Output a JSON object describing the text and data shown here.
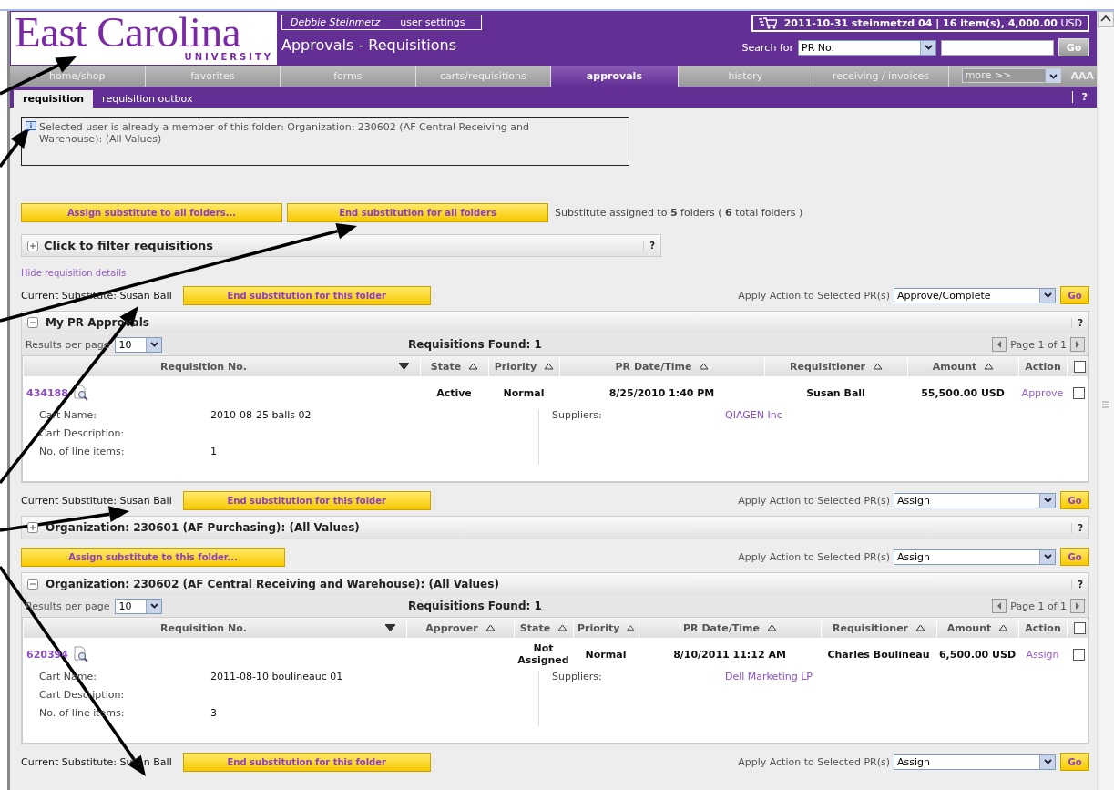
{
  "logo": {
    "name": "East Carolina",
    "sub": "UNIVERSITY"
  },
  "user": {
    "name": "Debbie Steinmetz",
    "settings": "user settings"
  },
  "page_title": "Approvals - Requisitions",
  "cart": {
    "summary": "**2011-10-31 steinmetzd 04 | 16 item(s), 4,000.00** USD"
  },
  "search": {
    "label": "Search for",
    "option": "PR No.",
    "go": "Go"
  },
  "nav": [
    {
      "label": "home/shop",
      "selected": false
    },
    {
      "label": "favorites",
      "selected": false
    },
    {
      "label": "forms",
      "selected": false
    },
    {
      "label": "carts/requisitions",
      "selected": false
    },
    {
      "label": "approvals",
      "selected": true
    },
    {
      "label": "history",
      "selected": false
    },
    {
      "label": "receiving / invoices",
      "selected": false
    }
  ],
  "more": "more >>",
  "text_size": "AAA",
  "subtabs": [
    {
      "label": "requisition",
      "selected": true
    },
    {
      "label": "requisition outbox",
      "selected": false
    }
  ],
  "help": "?",
  "notice": "Selected user is already a member of this folder: Organization: 230602 (AF Central Receiving and Warehouse): (All Values)",
  "bulk_buttons": [
    "Assign substitute to all folders...",
    "End substitution for all folders"
  ],
  "summary": "Substitute assigned to **5** folders ( **6** total folders )",
  "filter": {
    "label": "Click to filter requisitions",
    "help": "?"
  },
  "details_link": "Hide requisition details",
  "folders": [
    {
      "bar": {
        "substitute": "Current Substitute: Susan Ball",
        "button": "End substitution for this folder",
        "apply_label": "Apply Action to Selected PR(s)",
        "action": "Approve/Complete",
        "go": "Go"
      },
      "title": "My PR Approvals",
      "expanded": true,
      "help": "?",
      "results_label": "Results per page",
      "per_page": "10",
      "found": "Requisitions Found: 1",
      "page": "Page 1 of 1",
      "select_all_checked": false,
      "columns": [
        {
          "label": "Requisition No.",
          "sorted": true
        },
        {
          "label": "State",
          "sorted": false
        },
        {
          "label": "Priority",
          "sorted": false
        },
        {
          "label": "PR Date/Time",
          "sorted": false
        },
        {
          "label": "Requisitioner",
          "sorted": false
        },
        {
          "label": "Amount",
          "sorted": false
        },
        {
          "label": "Action"
        }
      ],
      "rows": [
        {
          "cells": [
            "434188",
            "Active",
            "Normal",
            "8/25/2010 1:40 PM",
            "Susan Ball",
            "55,500.00 USD",
            "Approve"
          ],
          "checked": false,
          "details": [
            {
              "label": "Cart Name:",
              "value": "2010-08-25 balls 02"
            },
            {
              "label": "Cart Description:"
            },
            {
              "label": "No. of line items:",
              "value": "1"
            }
          ],
          "suppliers": {
            "label": "Suppliers:",
            "value": "QIAGEN Inc"
          }
        }
      ]
    },
    {
      "bar": {
        "substitute": "Current Substitute: Susan Ball",
        "button": "End substitution for this folder",
        "apply_label": "Apply Action to Selected PR(s)",
        "action": "Assign",
        "go": "Go"
      },
      "title": "Organization: 230601 (AF Purchasing): (All Values)",
      "expanded": false,
      "help": "?"
    },
    {
      "bar": {
        "button": "Assign substitute to this folder...",
        "apply_label": "Apply Action to Selected PR(s)",
        "action": "Assign",
        "go": "Go"
      },
      "title": "Organization: 230602 (AF Central Receiving and Warehouse): (All Values)",
      "expanded": true,
      "help": "?",
      "results_label": "Results per page",
      "per_page": "10",
      "found": "Requisitions Found: 1",
      "page": "Page 1 of 1",
      "select_all_checked": false,
      "columns": [
        {
          "label": "Requisition No.",
          "sorted": true
        },
        {
          "label": "Approver",
          "sorted": false
        },
        {
          "label": "State",
          "sorted": false
        },
        {
          "label": "Priority",
          "sorted": false
        },
        {
          "label": "PR Date/Time",
          "sorted": false
        },
        {
          "label": "Requisitioner",
          "sorted": false
        },
        {
          "label": "Amount",
          "sorted": false
        },
        {
          "label": "Action"
        }
      ],
      "rows": [
        {
          "cells": [
            "620394",
            "",
            "Not Assigned",
            "Normal",
            "8/10/2011 11:12 AM",
            "Charles Boulineau",
            "6,500.00 USD",
            "Assign"
          ],
          "checked": false,
          "details": [
            {
              "label": "Cart Name:",
              "value": "2011-08-10 boulineauc 01"
            },
            {
              "label": "Cart Description:"
            },
            {
              "label": "No. of line items:",
              "value": "3"
            }
          ],
          "suppliers": {
            "label": "Suppliers:",
            "value": "Dell Marketing LP"
          }
        }
      ]
    },
    {
      "bar": {
        "substitute": "Current Substitute: Susan Ball",
        "button": "End substitution for this folder",
        "apply_label": "Apply Action to Selected PR(s)",
        "action": "Assign",
        "go": "Go"
      }
    }
  ]
}
